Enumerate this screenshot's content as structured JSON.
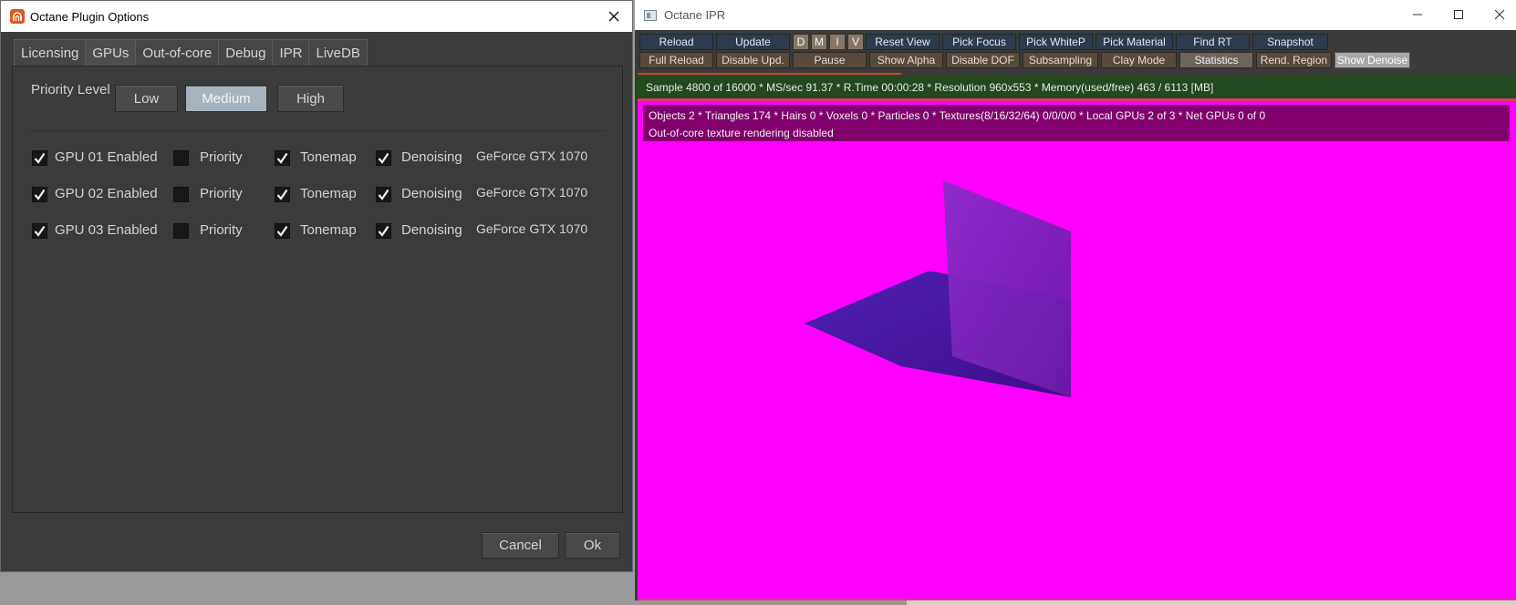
{
  "plugin_dialog": {
    "title": "Octane Plugin Options",
    "tabs": [
      {
        "label": "Licensing",
        "active": false
      },
      {
        "label": "GPUs",
        "active": true
      },
      {
        "label": "Out-of-core",
        "active": false
      },
      {
        "label": "Debug",
        "active": false
      },
      {
        "label": "IPR",
        "active": false
      },
      {
        "label": "LiveDB",
        "active": false
      }
    ],
    "priority_level": {
      "label": "Priority Level",
      "options": [
        "Low",
        "Medium",
        "High"
      ],
      "selected": "Medium"
    },
    "gpus": [
      {
        "enabled_label": "GPU 01 Enabled",
        "enabled": true,
        "priority_label": "Priority",
        "priority": false,
        "tonemap_label": "Tonemap",
        "tonemap": true,
        "denoising_label": "Denoising",
        "denoising": true,
        "device": "GeForce GTX 1070"
      },
      {
        "enabled_label": "GPU 02 Enabled",
        "enabled": true,
        "priority_label": "Priority",
        "priority": false,
        "tonemap_label": "Tonemap",
        "tonemap": true,
        "denoising_label": "Denoising",
        "denoising": true,
        "device": "GeForce GTX 1070"
      },
      {
        "enabled_label": "GPU 03 Enabled",
        "enabled": true,
        "priority_label": "Priority",
        "priority": false,
        "tonemap_label": "Tonemap",
        "tonemap": true,
        "denoising_label": "Denoising",
        "denoising": true,
        "device": "GeForce GTX 1070"
      }
    ],
    "cancel_label": "Cancel",
    "ok_label": "Ok",
    "icons": {
      "logo": "houdini-logo-icon",
      "close": "close-icon",
      "check": "checkmark-icon"
    },
    "colors": {
      "logo": "#e8541c",
      "selected_option": "#a6b3bf"
    }
  },
  "ipr_window": {
    "title": "Octane IPR",
    "icons": {
      "window": "window-icon",
      "minimize": "minimize-icon",
      "maximize": "maximize-icon",
      "close": "close-icon"
    },
    "toolbar_row1": [
      {
        "label": "Reload",
        "style": "blue"
      },
      {
        "label": "Update",
        "style": "blue"
      },
      {
        "label": "D",
        "style": "small"
      },
      {
        "label": "M",
        "style": "small"
      },
      {
        "label": "I",
        "style": "small"
      },
      {
        "label": "V",
        "style": "small"
      },
      {
        "label": "Reset View",
        "style": "blue"
      },
      {
        "label": "Pick Focus",
        "style": "blue"
      },
      {
        "label": "Pick WhiteP",
        "style": "blue"
      },
      {
        "label": "Pick Material",
        "style": "blue"
      },
      {
        "label": "Find RT",
        "style": "blue"
      },
      {
        "label": "Snapshot",
        "style": "blue"
      }
    ],
    "toolbar_row2": [
      {
        "label": "Full Reload",
        "style": "brown"
      },
      {
        "label": "Disable Upd.",
        "style": "brown"
      },
      {
        "label": "Pause",
        "style": "brown"
      },
      {
        "label": "Show Alpha",
        "style": "brown"
      },
      {
        "label": "Disable DOF",
        "style": "brown"
      },
      {
        "label": "Subsampling",
        "style": "brown"
      },
      {
        "label": "Clay Mode",
        "style": "brown"
      },
      {
        "label": "Statistics",
        "style": "hl"
      },
      {
        "label": "Rend. Region",
        "style": "brown"
      },
      {
        "label": "Show Denoise",
        "style": "sel"
      }
    ],
    "status_line": "Sample 4800 of 16000 * MS/sec 91.37 * R.Time 00:00:28 * Resolution 960x553 * Memory(used/free) 463 / 6113 [MB]",
    "render_progress": 0.3,
    "overlay_line1": "Objects 2 * Triangles 174 * Hairs 0 * Voxels 0 * Particles 0 * Textures(8/16/32/64) 0/0/0/0 * Local GPUs 2 of 3 * Net GPUs 0 of 0",
    "overlay_line2": "Out-of-core texture rendering disabled",
    "colors": {
      "viewport_background": "#ff00ff",
      "status_bar": "#24481f",
      "overlay": "#82006d",
      "plane_floor": "#4a1a9e",
      "plane_wall": "#7a1fb0"
    }
  }
}
